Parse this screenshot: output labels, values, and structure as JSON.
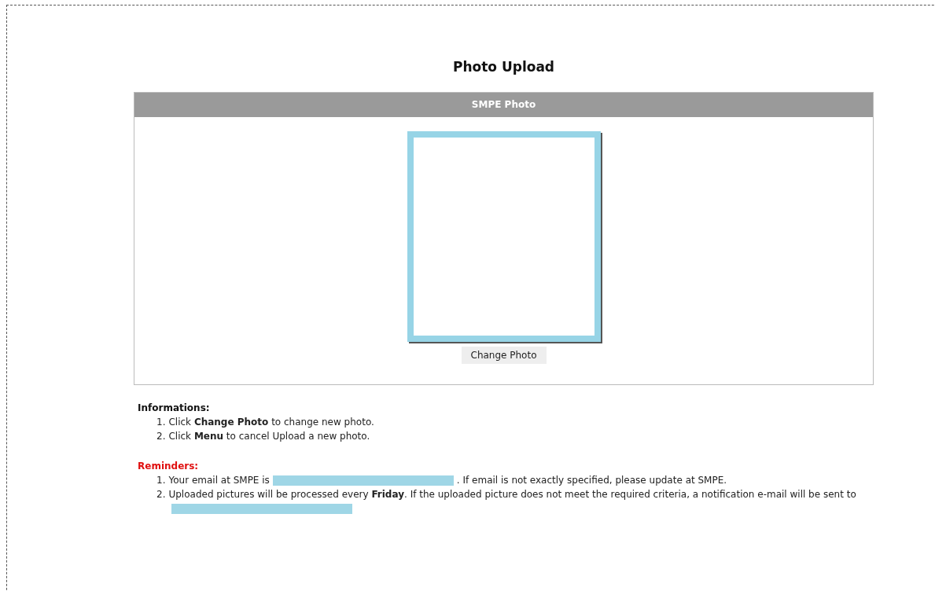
{
  "page_title": "Photo Upload",
  "panel": {
    "header": "SMPE Photo",
    "photo": {
      "kind": "empty"
    },
    "button": "Change Photo"
  },
  "informations": {
    "heading": "Informations:",
    "items": [
      {
        "number": "1.",
        "text": "Click **Change Photo** to change new photo."
      },
      {
        "number": "2.",
        "text": "Click **Menu** to cancel Upload a new photo."
      }
    ]
  },
  "reminders": {
    "heading": "Reminders:",
    "items": [
      {
        "number": "1.",
        "parts": [
          {
            "kind": "text",
            "text": "Your email at SMPE is"
          },
          {
            "kind": "redaction"
          },
          {
            "kind": "text",
            "text": ". If email is not exactly specified, please update at SMPE."
          }
        ]
      },
      {
        "number": "2.",
        "parts": [
          {
            "kind": "text",
            "text": "Uploaded pictures will be processed every **Friday**. If the uploaded picture does not meet the required criteria, a notification e-mail will be sent to"
          },
          {
            "kind": "redaction"
          }
        ]
      }
    ]
  }
}
